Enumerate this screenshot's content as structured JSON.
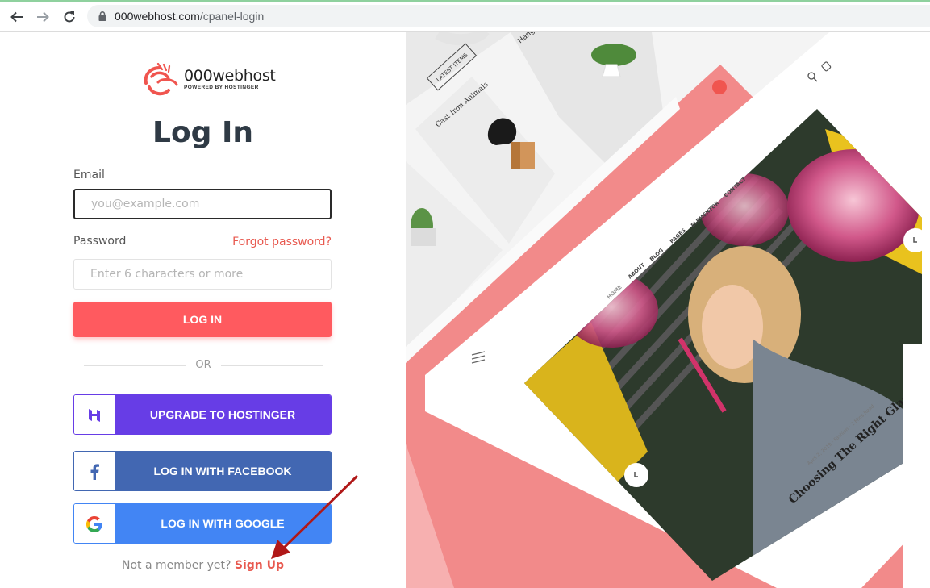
{
  "browser": {
    "url_host": "000webhost.com",
    "url_path": "/cpanel-login"
  },
  "brand": {
    "name": "000webhost",
    "tagline": "POWERED BY HOSTINGER"
  },
  "form": {
    "title": "Log In",
    "email_label": "Email",
    "email_placeholder": "you@example.com",
    "email_value": "",
    "password_label": "Password",
    "password_placeholder": "Enter 6 characters or more",
    "forgot_label": "Forgot password?",
    "login_button": "LOG IN",
    "or_label": "OR",
    "hostinger_button": "UPGRADE TO HOSTINGER",
    "facebook_button": "LOG IN WITH FACEBOOK",
    "google_button": "LOG IN WITH GOOGLE",
    "member_prompt": "Not a member yet?",
    "signup_link": "Sign Up"
  },
  "promo": {
    "latest_items": "LATEST ITEMS",
    "product_label": "Cast Iron Animals",
    "hanging_label": "Hang",
    "nav_items": [
      "HOME",
      "ABOUT",
      "BLOG",
      "PAGES",
      "ELEMENTOR",
      "CONTACT"
    ],
    "post_meta": "April 2, 2019  ·  Fashion  ·  2 Mins Read",
    "post_title": "Choosing The Right Glass Sh"
  },
  "colors": {
    "accent": "#ff5a5f",
    "hostinger": "#673de6",
    "facebook": "#4267b2",
    "google": "#4285f4",
    "promo_bg": "#f28a8a"
  }
}
